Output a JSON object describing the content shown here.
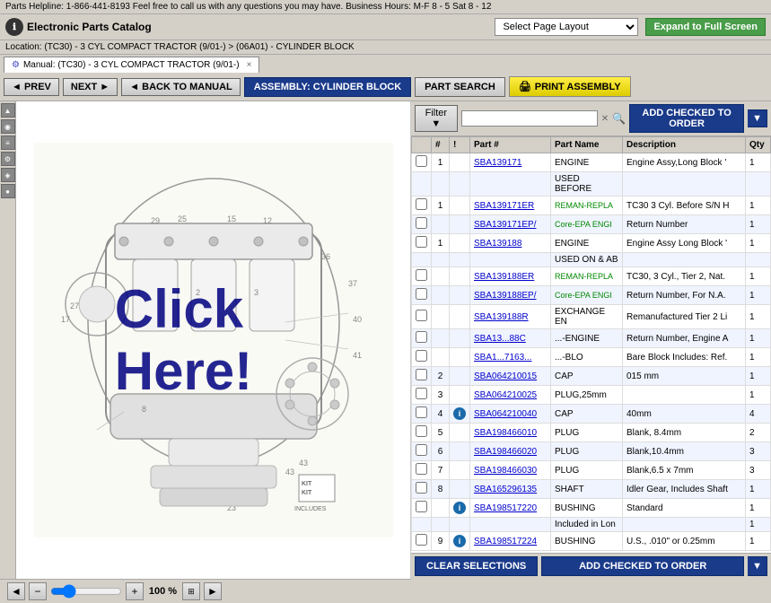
{
  "topbar": {
    "helpline": "Parts Helpline: 1-866-441-8193 Feel free to call us with any questions you may have. Business Hours: M-F 8 - 5 Sat 8 - 12"
  },
  "header": {
    "logo_label": "ℹ",
    "app_title": "Electronic Parts Catalog",
    "page_layout_placeholder": "Select Page Layout",
    "expand_btn": "Expand to Full Screen"
  },
  "breadcrumb": {
    "text": "Location: (TC30) - 3 CYL COMPACT TRACTOR (9/01-) > (06A01) - CYLINDER BLOCK"
  },
  "tab": {
    "icon": "⚙",
    "label": "Manual: (TC30) - 3 CYL COMPACT TRACTOR (9/01-)",
    "close": "×"
  },
  "toolbar": {
    "prev": "◄ PREV",
    "next": "NEXT ►",
    "back_to_manual": "◄ BACK TO MANUAL",
    "assembly": "ASSEMBLY: CYLINDER BLOCK",
    "part_search": "PART SEARCH",
    "print_icon": "🖨",
    "print_assembly": "PRINT ASSEMBLY"
  },
  "filter": {
    "label": "Filter ▼",
    "placeholder": "",
    "clear": "✕",
    "search": "🔍",
    "add_checked_top": "ADD CHECKED TO ORDER",
    "dropdown_arrow": "▼"
  },
  "table": {
    "headers": [
      "",
      "#",
      "!",
      "Part #",
      "Part Name",
      "Description",
      "Qty"
    ],
    "rows": [
      {
        "check": "",
        "num": "1",
        "info": "",
        "part": "SBA139171",
        "name": "ENGINE",
        "desc": "Engine Assy,Long Block '",
        "qty": "1"
      },
      {
        "check": "",
        "num": "",
        "info": "",
        "part": "",
        "name": "USED BEFORE",
        "desc": "",
        "qty": ""
      },
      {
        "check": "",
        "num": "1",
        "info": "",
        "part": "SBA139171ER",
        "name": "REMAN-REPLA",
        "desc": "TC30 3 Cyl. Before S/N H",
        "qty": "1"
      },
      {
        "check": "",
        "num": "",
        "info": "",
        "part": "SBA139171EP/",
        "name": "Core-EPA ENGI",
        "desc": "Return Number",
        "qty": "1"
      },
      {
        "check": "",
        "num": "1",
        "info": "",
        "part": "SBA139188",
        "name": "ENGINE",
        "desc": "Engine Assy Long Block '",
        "qty": "1"
      },
      {
        "check": "",
        "num": "",
        "info": "",
        "part": "",
        "name": "USED ON & AB",
        "desc": "",
        "qty": ""
      },
      {
        "check": "",
        "num": "",
        "info": "",
        "part": "SBA139188ER",
        "name": "REMAN-REPLA",
        "desc": "TC30, 3 Cyl., Tier 2, Nat.",
        "qty": "1"
      },
      {
        "check": "",
        "num": "",
        "info": "",
        "part": "SBA139188EP/",
        "name": "Core-EPA ENGI",
        "desc": "Return Number, For N.A.",
        "qty": "1"
      },
      {
        "check": "",
        "num": "",
        "info": "",
        "part": "SBA139188R",
        "name": "EXCHANGE EN",
        "desc": "Remanufactured Tier 2 Li",
        "qty": "1"
      },
      {
        "check": "",
        "num": "",
        "info": "",
        "part": "SBA13...88C",
        "name": "...-ENGINE",
        "desc": "Return Number, Engine A",
        "qty": "1"
      },
      {
        "check": "",
        "num": "",
        "info": "",
        "part": "SBA1...7163...",
        "name": "...-BLO",
        "desc": "Bare Block Includes: Ref.",
        "qty": "1"
      },
      {
        "check": "",
        "num": "2",
        "info": "",
        "part": "SBA064210015",
        "name": "CAP",
        "desc": "015 mm",
        "qty": "1"
      },
      {
        "check": "",
        "num": "3",
        "info": "",
        "part": "SBA064210025",
        "name": "PLUG,25mm",
        "desc": "",
        "qty": "1"
      },
      {
        "check": "",
        "num": "4",
        "info": "i",
        "part": "SBA064210040",
        "name": "CAP",
        "desc": "40mm",
        "qty": "4"
      },
      {
        "check": "",
        "num": "5",
        "info": "",
        "part": "SBA198466010",
        "name": "PLUG",
        "desc": "Blank, 8.4mm",
        "qty": "2"
      },
      {
        "check": "",
        "num": "6",
        "info": "",
        "part": "SBA198466020",
        "name": "PLUG",
        "desc": "Blank,10.4mm",
        "qty": "3"
      },
      {
        "check": "",
        "num": "7",
        "info": "",
        "part": "SBA198466030",
        "name": "PLUG",
        "desc": "Blank,6.5 x 7mm",
        "qty": "3"
      },
      {
        "check": "",
        "num": "8",
        "info": "",
        "part": "SBA165296135",
        "name": "SHAFT",
        "desc": "Idler Gear, Includes Shaft",
        "qty": "1"
      },
      {
        "check": "",
        "num": "",
        "info": "i",
        "part": "SBA198517220",
        "name": "BUSHING",
        "desc": "Standard",
        "qty": "1"
      },
      {
        "check": "",
        "num": "",
        "info": "",
        "part": "",
        "name": "Included in Lon",
        "desc": "",
        "qty": "1"
      },
      {
        "check": "",
        "num": "9",
        "info": "i",
        "part": "SBA198517224",
        "name": "BUSHING",
        "desc": "U.S., .010\" or 0.25mm",
        "qty": "1"
      }
    ]
  },
  "bottom": {
    "clear_selections": "CLEAR SELECTIONS",
    "add_checked": "ADD CHECKED TO ORDER",
    "dropdown_arrow": "▼"
  },
  "zoom": {
    "zoom_out": "−",
    "zoom_in": "+",
    "percent": "100 %",
    "nav_left": "◄",
    "nav_right": "►"
  }
}
